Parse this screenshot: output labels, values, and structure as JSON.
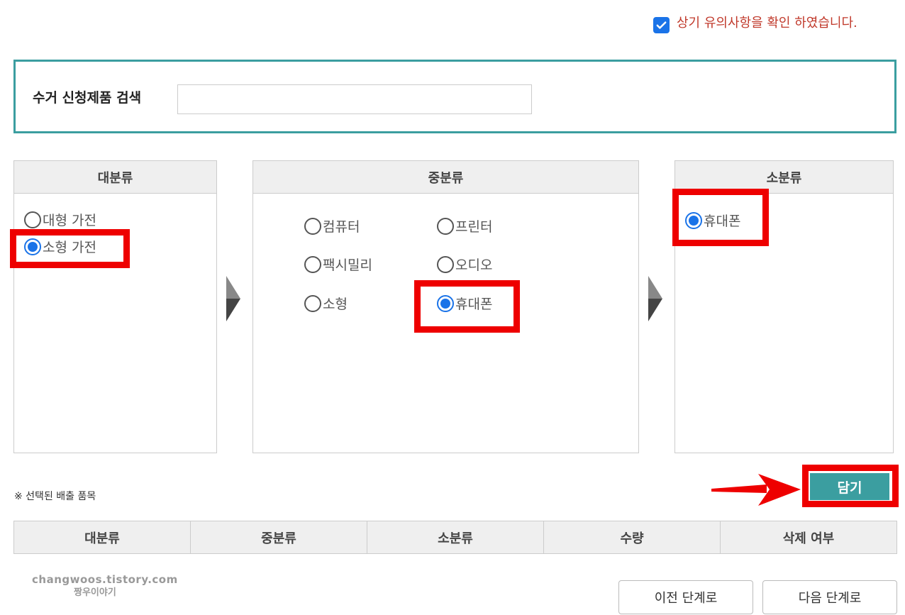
{
  "agree": {
    "checked": true,
    "text": "상기 유의사항을 확인 하였습니다."
  },
  "search": {
    "label": "수거 신청제품 검색",
    "value": "",
    "placeholder": ""
  },
  "major": {
    "title": "대분류",
    "options": [
      {
        "label": "대형 가전",
        "selected": false
      },
      {
        "label": "소형 가전",
        "selected": true
      }
    ]
  },
  "middle": {
    "title": "중분류",
    "options": [
      {
        "label": "컴퓨터",
        "selected": false
      },
      {
        "label": "프린터",
        "selected": false
      },
      {
        "label": "팩시밀리",
        "selected": false
      },
      {
        "label": "오디오",
        "selected": false
      },
      {
        "label": "소형",
        "selected": false
      },
      {
        "label": "휴대폰",
        "selected": true
      }
    ]
  },
  "minor": {
    "title": "소분류",
    "options": [
      {
        "label": "휴대폰",
        "selected": true
      }
    ]
  },
  "add_button": "담기",
  "selected_note": "※ 선택된 배출 품목",
  "table": {
    "headers": [
      "대분류",
      "중분류",
      "소분류",
      "수량",
      "삭제 여부"
    ]
  },
  "watermark": {
    "line1": "changwoos.tistory.com",
    "line2": "짱우이야기"
  },
  "nav": {
    "prev": "이전 단계로",
    "next": "다음 단계로"
  },
  "colors": {
    "accent": "#3b9ea0",
    "radio": "#1a73e8",
    "highlight": "#ee0000",
    "notice": "#c0392b"
  }
}
